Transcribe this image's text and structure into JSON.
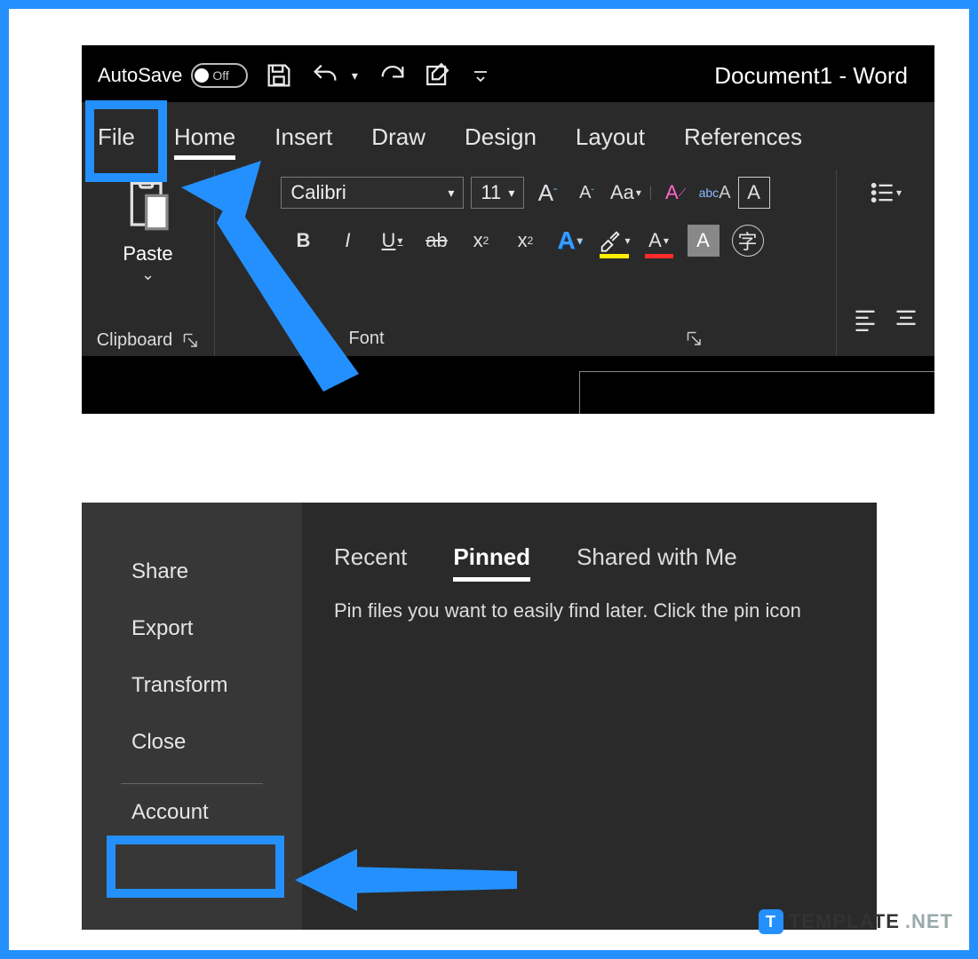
{
  "top": {
    "qat": {
      "autosave_label": "AutoSave",
      "autosave_state": "Off",
      "title": "Document1  -  Word"
    },
    "tabs": {
      "file": "File",
      "home": "Home",
      "insert": "Insert",
      "draw": "Draw",
      "design": "Design",
      "layout": "Layout",
      "references": "References"
    },
    "clipboard": {
      "paste": "Paste",
      "group_label": "Clipboard"
    },
    "font": {
      "name": "Calibri",
      "size": "11",
      "group_label": "Font",
      "bold": "B",
      "italic": "I",
      "underline": "U",
      "strike": "ab",
      "subscript": "x",
      "sub_suffix": "2",
      "superscript": "x",
      "sup_suffix": "2",
      "case": "Aa",
      "clear": "A",
      "grow_base": "A",
      "grow_sup": "ˆ",
      "shrink_base": "A",
      "shrink_sup": "ˇ",
      "text_effects": "A",
      "highlight": "⬐",
      "font_color": "A",
      "shading": "A",
      "border": "字"
    }
  },
  "bottom": {
    "side": {
      "share": "Share",
      "export": "Export",
      "transform": "Transform",
      "close": "Close",
      "account": "Account"
    },
    "tabs": {
      "recent": "Recent",
      "pinned": "Pinned",
      "shared": "Shared with Me"
    },
    "pinned_text": "Pin files you want to easily find later. Click the pin icon"
  },
  "watermark": {
    "badge": "T",
    "brand": "TEMPLATE",
    "suffix": ".NET"
  }
}
